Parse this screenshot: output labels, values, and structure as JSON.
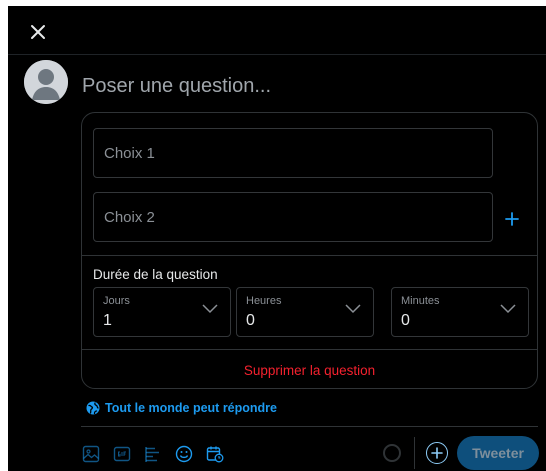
{
  "header": {
    "close_icon": "close-icon"
  },
  "composer": {
    "avatar_icon": "default-avatar-icon",
    "placeholder": "Poser une question..."
  },
  "poll": {
    "choices": [
      {
        "placeholder": "Choix 1"
      },
      {
        "placeholder": "Choix 2"
      }
    ],
    "add_choice_icon": "plus-icon",
    "duration_title": "Durée de la question",
    "duration": {
      "days": {
        "label": "Jours",
        "value": "1"
      },
      "hours": {
        "label": "Heures",
        "value": "0"
      },
      "minutes": {
        "label": "Minutes",
        "value": "0"
      }
    },
    "remove_label": "Supprimer la question"
  },
  "reply_setting": {
    "icon": "globe-icon",
    "label": "Tout le monde peut répondre"
  },
  "toolbar": {
    "icons": [
      "image-icon",
      "gif-icon",
      "poll-icon",
      "emoji-icon",
      "schedule-icon"
    ]
  },
  "footer": {
    "add_icon": "plus-circle-icon",
    "tweet_label": "Tweeter"
  },
  "colors": {
    "background": "#000000",
    "accent": "#1d9bf0",
    "danger": "#f4212e",
    "border": "#2f3336",
    "tweet_button": "#0e4f7c"
  }
}
